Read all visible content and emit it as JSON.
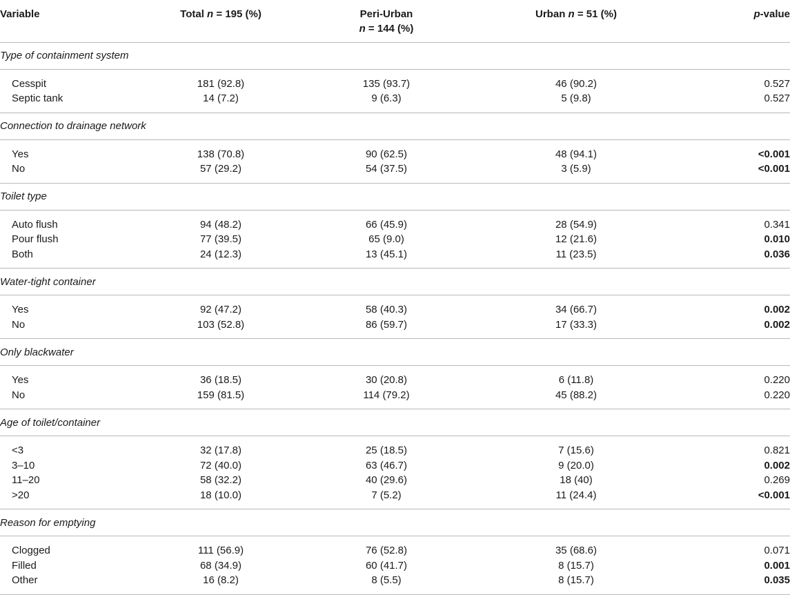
{
  "header": {
    "variable": "Variable",
    "total_prefix": "Total",
    "total_n": "n",
    "total_suffix": " = 195 (%)",
    "peri_line1": "Peri-Urban",
    "peri_n": "n",
    "peri_suffix": " = 144 (%)",
    "urban_prefix": "Urban",
    "urban_n": "n",
    "urban_suffix": " = 51 (%)",
    "p_prefix": "p",
    "p_suffix": "-value"
  },
  "groups": [
    {
      "title": "Type of containment system",
      "rows": [
        {
          "label": "Cesspit",
          "total": "181 (92.8)",
          "peri": "135 (93.7)",
          "urban": "46 (90.2)",
          "p": "0.527",
          "p_bold": false
        },
        {
          "label": "Septic tank",
          "total": "14 (7.2)",
          "peri": "9 (6.3)",
          "urban": "5 (9.8)",
          "p": "0.527",
          "p_bold": false
        }
      ]
    },
    {
      "title": "Connection to drainage network",
      "rows": [
        {
          "label": "Yes",
          "total": "138 (70.8)",
          "peri": "90 (62.5)",
          "urban": "48 (94.1)",
          "p": "<0.001",
          "p_bold": true
        },
        {
          "label": "No",
          "total": "57 (29.2)",
          "peri": "54 (37.5)",
          "urban": "3 (5.9)",
          "p": "<0.001",
          "p_bold": true
        }
      ]
    },
    {
      "title": "Toilet type",
      "rows": [
        {
          "label": "Auto flush",
          "total": "94 (48.2)",
          "peri": "66 (45.9)",
          "urban": "28 (54.9)",
          "p": "0.341",
          "p_bold": false
        },
        {
          "label": "Pour flush",
          "total": "77 (39.5)",
          "peri": "65 (9.0)",
          "urban": "12 (21.6)",
          "p": "0.010",
          "p_bold": true
        },
        {
          "label": "Both",
          "total": "24 (12.3)",
          "peri": "13 (45.1)",
          "urban": "11 (23.5)",
          "p": "0.036",
          "p_bold": true
        }
      ]
    },
    {
      "title": "Water-tight container",
      "rows": [
        {
          "label": "Yes",
          "total": "92 (47.2)",
          "peri": "58 (40.3)",
          "urban": "34 (66.7)",
          "p": "0.002",
          "p_bold": true
        },
        {
          "label": "No",
          "total": "103 (52.8)",
          "peri": "86 (59.7)",
          "urban": "17 (33.3)",
          "p": "0.002",
          "p_bold": true
        }
      ]
    },
    {
      "title": "Only blackwater",
      "rows": [
        {
          "label": "Yes",
          "total": "36 (18.5)",
          "peri": "30 (20.8)",
          "urban": "6 (11.8)",
          "p": "0.220",
          "p_bold": false
        },
        {
          "label": "No",
          "total": "159 (81.5)",
          "peri": "114 (79.2)",
          "urban": "45 (88.2)",
          "p": "0.220",
          "p_bold": false
        }
      ]
    },
    {
      "title": "Age of toilet/container",
      "rows": [
        {
          "label": "<3",
          "total": "32 (17.8)",
          "peri": "25 (18.5)",
          "urban": "7 (15.6)",
          "p": "0.821",
          "p_bold": false
        },
        {
          "label": "3–10",
          "total": "72 (40.0)",
          "peri": "63 (46.7)",
          "urban": "9 (20.0)",
          "p": "0.002",
          "p_bold": true
        },
        {
          "label": "11–20",
          "total": "58 (32.2)",
          "peri": "40 (29.6)",
          "urban": "18 (40)",
          "p": "0.269",
          "p_bold": false
        },
        {
          "label": ">20",
          "total": "18 (10.0)",
          "peri": "7 (5.2)",
          "urban": "11 (24.4)",
          "p": "<0.001",
          "p_bold": true
        }
      ]
    },
    {
      "title": "Reason for emptying",
      "rows": [
        {
          "label": "Clogged",
          "total": "111 (56.9)",
          "peri": "76 (52.8)",
          "urban": "35 (68.6)",
          "p": "0.071",
          "p_bold": false
        },
        {
          "label": "Filled",
          "total": "68 (34.9)",
          "peri": "60 (41.7)",
          "urban": "8 (15.7)",
          "p": "0.001",
          "p_bold": true
        },
        {
          "label": "Other",
          "total": "16 (8.2)",
          "peri": "8 (5.5)",
          "urban": "8 (15.7)",
          "p": "0.035",
          "p_bold": true
        }
      ]
    }
  ]
}
